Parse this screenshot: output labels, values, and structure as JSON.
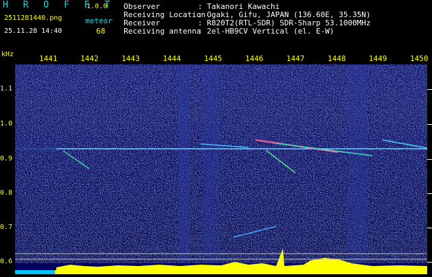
{
  "app": {
    "logo": "H R O F F T",
    "version": "1.0.0"
  },
  "file": {
    "name": "2511281440.png",
    "datetime": "25.11.28 14:40"
  },
  "counter": {
    "label": "meteor",
    "value": "68"
  },
  "station": {
    "observer_label": "Observer",
    "observer_value": ": Takanori Kawachi",
    "location_label": "Receiving Location",
    "location_value": ": Ogaki, Gifu, JAPAN (136.60E, 35.35N)",
    "receiver_label": "Receiver",
    "receiver_value": ": R820T2(RTL-SDR) SDR-Sharp 53.1000MHz",
    "antenna_label": "Receiving antenna",
    "antenna_value": ": 2el-HB9CV Vertical (el. E-W)"
  },
  "axes": {
    "y_unit": "kHz",
    "y_ticks": [
      "1.1",
      "1.0",
      "0.9",
      "0.8",
      "0.7",
      "0.6"
    ],
    "x_ticks": [
      "1441",
      "1442",
      "1443",
      "1444",
      "1445",
      "1446",
      "1447",
      "1448",
      "1449",
      "1450"
    ]
  },
  "colors": {
    "background": "#0a0a3c",
    "noise": "#3050d0",
    "accent": "#ffff00",
    "label": "#00e6e6"
  }
}
